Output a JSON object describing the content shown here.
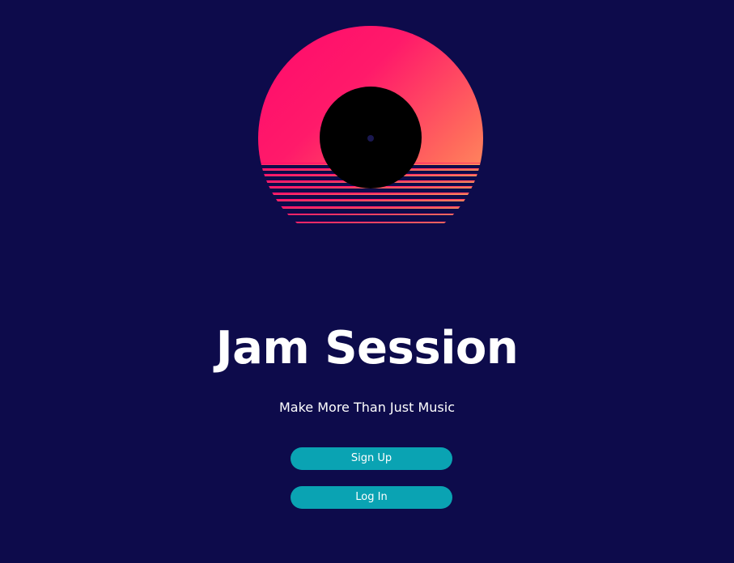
{
  "app": {
    "title": "Jam Session",
    "tagline": "Make More Than Just Music"
  },
  "buttons": {
    "signup_label": "Sign Up",
    "login_label": "Log In"
  },
  "colors": {
    "background": "#0d0b4b",
    "button": "#0aa3b3",
    "text": "#ffffff",
    "logo_gradient_start": "#ff0a6c",
    "logo_gradient_end": "#ffb060"
  },
  "icons": {
    "logo": "vinyl-sunset-logo"
  }
}
